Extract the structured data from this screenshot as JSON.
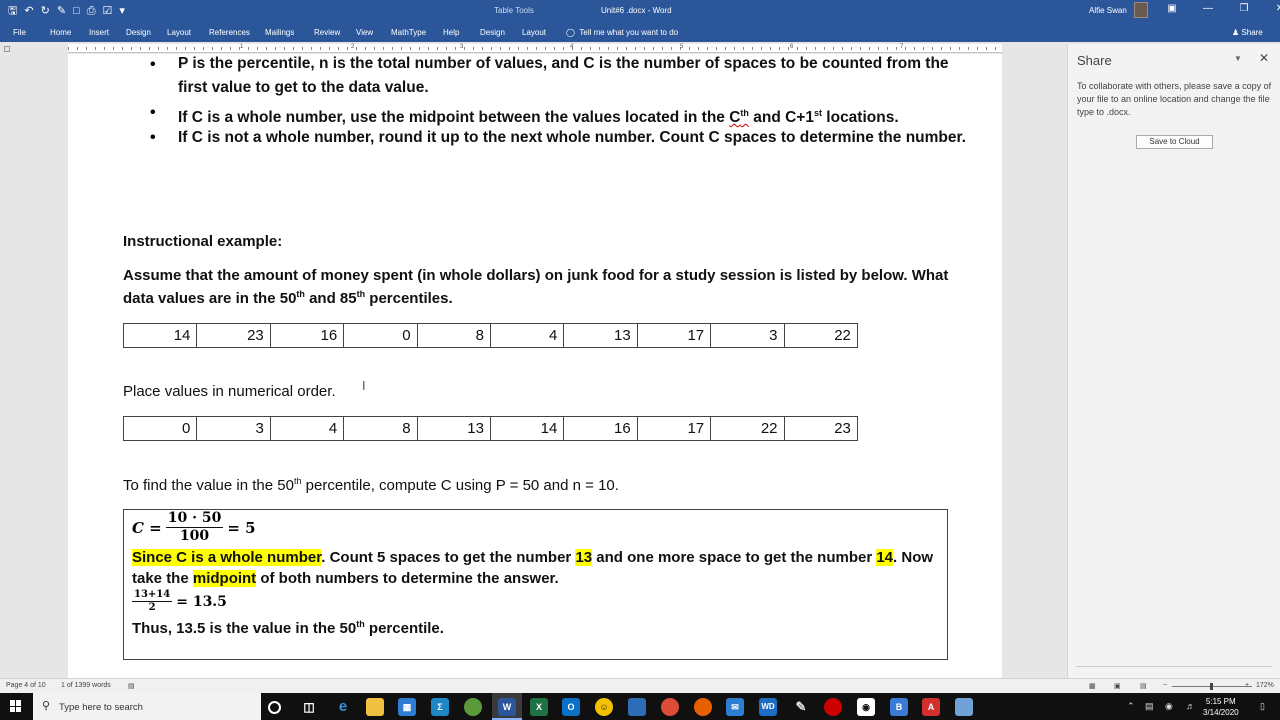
{
  "titlebar": {
    "context_tab": "Table Tools",
    "document_title": "Unit#6 .docx  -  Word",
    "user": "Alfie Swan"
  },
  "ribbon": {
    "tabs": [
      "File",
      "Home",
      "Insert",
      "Design",
      "Layout",
      "References",
      "Mailings",
      "Review",
      "View",
      "MathType",
      "Help",
      "Design",
      "Layout"
    ],
    "tell_me": "Tell me what you want to do",
    "share": "Share"
  },
  "document": {
    "bullets": [
      "P is the percentile, n is the total number of values, and C is the number of spaces to be counted from the first value to get to the data value.",
      "If C is not a whole number, round it up to the next whole number. Count C spaces to determine the number."
    ],
    "bullet2": {
      "pre": "If C is a whole number, use the midpoint between the values located in the ",
      "c": "C",
      "th": "th",
      "mid": " and C+1",
      "st": "st",
      "post": " locations."
    },
    "instructional_heading": "Instructional example:",
    "problem": {
      "line1": "Assume that the amount of money spent (in whole dollars) on junk food for a study session is listed by below. What",
      "line2_pre": "data values are in the 50",
      "th1": "th",
      "line2_mid": " and 85",
      "th2": "th",
      "line2_post": " percentiles."
    },
    "data_values": [
      "14",
      "23",
      "16",
      "0",
      "8",
      "4",
      "13",
      "17",
      "3",
      "22"
    ],
    "order_instruction": "Place values in numerical order.",
    "sorted_values": [
      "0",
      "3",
      "4",
      "8",
      "13",
      "14",
      "16",
      "17",
      "22",
      "23"
    ],
    "find_text": {
      "pre": "To find the value in the 50",
      "th": "th",
      "post": " percentile, compute C using P = 50 and n = 10."
    },
    "work": {
      "c_label": "C =",
      "c_num": "10 · 50",
      "c_den": "100",
      "c_result": "= 5",
      "line1_hl": "Since C is a whole number",
      "line1_a": ". Count 5 spaces to get the number ",
      "hl_13": "13",
      "line1_b": " and one more space to get the number ",
      "hl_14": "14",
      "line1_c": ". Now",
      "line2_a": "take the ",
      "hl_mid": "midpoint",
      "line2_b": " of both numbers to determine the answer.",
      "mid_num": "13+14",
      "mid_den": "2",
      "mid_result": "= 13.5",
      "thus_pre": "Thus, 13.5 is the value in the 50",
      "thus_th": "th",
      "thus_post": " percentile."
    }
  },
  "share_pane": {
    "title": "Share",
    "description": "To collaborate with others, please save a copy of your file to an online location and change the file type to .docx.",
    "save_button": "Save to Cloud"
  },
  "statusbar": {
    "page": "Page 4 of 10",
    "words": "1 of 1399 words",
    "zoom": "172%"
  },
  "taskbar": {
    "search_placeholder": "Type here to search",
    "time": "5:15 PM",
    "date": "3/14/2020"
  }
}
